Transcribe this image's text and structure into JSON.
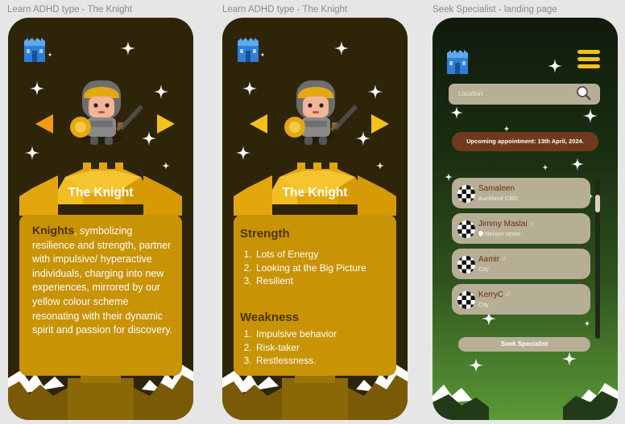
{
  "frames": [
    {
      "label": "Learn ADHD type - The Knight",
      "knight_title": "The Knight",
      "description": {
        "lead": "Knights",
        "text": ", symbolizing resilience and strength, partner with impulsive/ hyperactive individuals, charging into new experiences, mirrored by our yellow colour scheme resonating with their dynamic spirit and passion for discovery."
      },
      "icons": [
        "castle-logo-icon",
        "arrow-left-icon",
        "arrow-right-icon",
        "sparkle-icon"
      ]
    },
    {
      "label": "Learn ADHD type - The Knight",
      "knight_title": "The Knight",
      "strength": {
        "title": "Strength",
        "items": [
          "Lots of Energy",
          "Looking at the Big Picture",
          "Resilient"
        ]
      },
      "weakness": {
        "title": "Weakness",
        "items": [
          "Impulsive behavior",
          "Risk-taker",
          "Restlessness."
        ]
      },
      "icons": [
        "castle-logo-icon",
        "arrow-left-icon",
        "arrow-right-icon"
      ]
    },
    {
      "label": "Seek Specialist - landing page",
      "search": {
        "placeholder": "Location",
        "icon": "search-icon"
      },
      "appointment": "Upcoming appointment: 13th April, 2024.",
      "specialists": [
        {
          "name": "Samaleen",
          "gender": "",
          "location": "Auckland CBD",
          "pin": false
        },
        {
          "name": "Jimmy Maslai",
          "gender": "♂",
          "location": "Nelson street",
          "pin": true
        },
        {
          "name": "Aamir",
          "gender": "♂",
          "location": "City",
          "pin": false
        },
        {
          "name": "KerryC",
          "gender": "♂",
          "location": "City",
          "pin": false
        }
      ],
      "button": "Seek Specialist",
      "icons": [
        "castle-logo-icon",
        "hamburger-menu-icon"
      ]
    }
  ],
  "colors": {
    "brown_bg": "#2e2408",
    "gold_card": "#c99306",
    "gold_accent": "#f2c21b",
    "appointment_bg": "#6f3a1e",
    "pill_bg": "#b7ae96",
    "name_color": "#6b2f10"
  }
}
